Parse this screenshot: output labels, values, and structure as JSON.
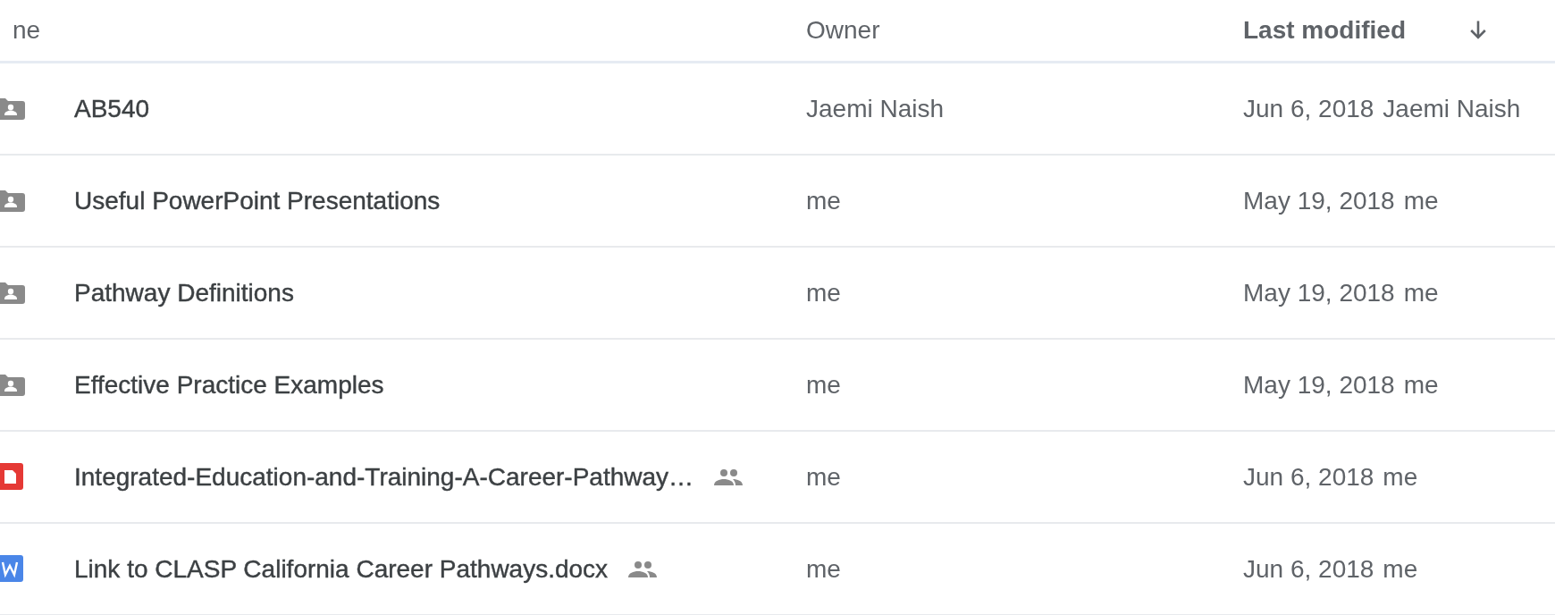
{
  "columns": [
    {
      "label": "ne",
      "kind": "name"
    },
    {
      "label": "Owner",
      "kind": "owner"
    },
    {
      "label": "Last modified",
      "kind": "modified",
      "sorted": true
    }
  ],
  "rows": [
    {
      "kind": "shared-folder",
      "name": "AB540",
      "shared": false,
      "owner": "Jaemi Naish",
      "modified": "Jun 6, 2018",
      "modified_by": "Jaemi Naish"
    },
    {
      "kind": "shared-folder",
      "name": "Useful PowerPoint Presentations",
      "shared": false,
      "owner": "me",
      "modified": "May 19, 2018",
      "modified_by": "me"
    },
    {
      "kind": "shared-folder",
      "name": "Pathway Definitions",
      "shared": false,
      "owner": "me",
      "modified": "May 19, 2018",
      "modified_by": "me"
    },
    {
      "kind": "shared-folder",
      "name": "Effective Practice Examples",
      "shared": false,
      "owner": "me",
      "modified": "May 19, 2018",
      "modified_by": "me"
    },
    {
      "kind": "pdf",
      "name": "Integrated-Education-and-Training-A-Career-Pathway…",
      "shared": true,
      "owner": "me",
      "modified": "Jun 6, 2018",
      "modified_by": "me"
    },
    {
      "kind": "word",
      "name": "Link to CLASP California Career Pathways.docx",
      "shared": true,
      "owner": "me",
      "modified": "Jun 6, 2018",
      "modified_by": "me"
    }
  ]
}
